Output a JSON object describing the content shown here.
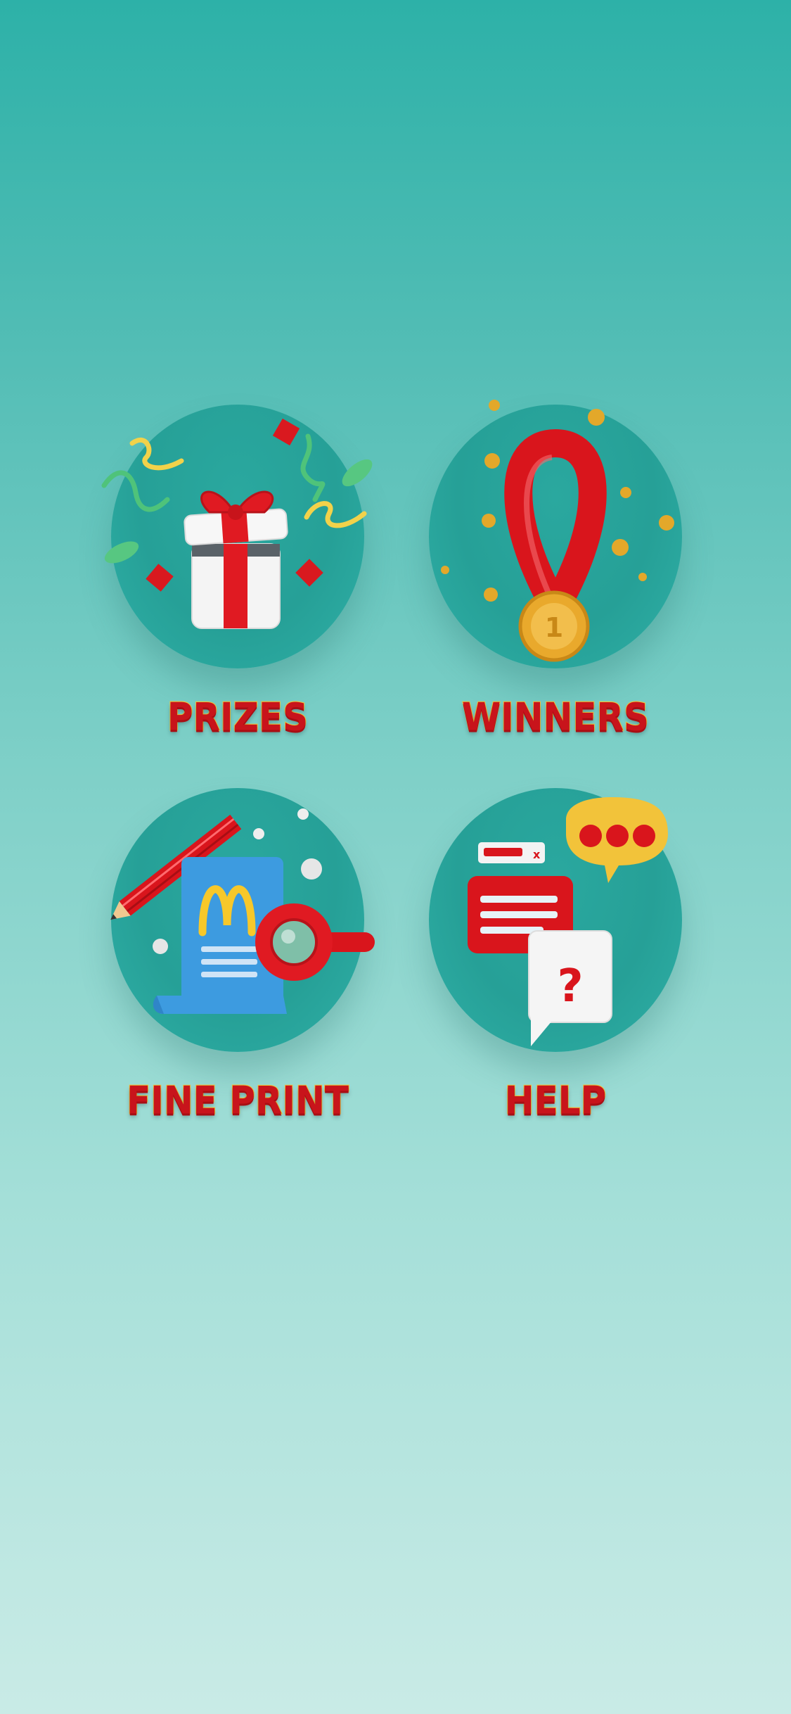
{
  "menu": {
    "items": [
      {
        "label": "PRIZES",
        "icon": "gift-box-icon"
      },
      {
        "label": "WINNERS",
        "icon": "medal-icon"
      },
      {
        "label": "FINE PRINT",
        "icon": "document-magnifier-icon"
      },
      {
        "label": "HELP",
        "icon": "chat-help-icon"
      }
    ]
  },
  "colors": {
    "label_red": "#c8141b",
    "label_outline": "#f0c43a",
    "disc_teal": "#26a097",
    "background_top": "#2db1a8",
    "background_bottom": "#c9ebe6"
  }
}
